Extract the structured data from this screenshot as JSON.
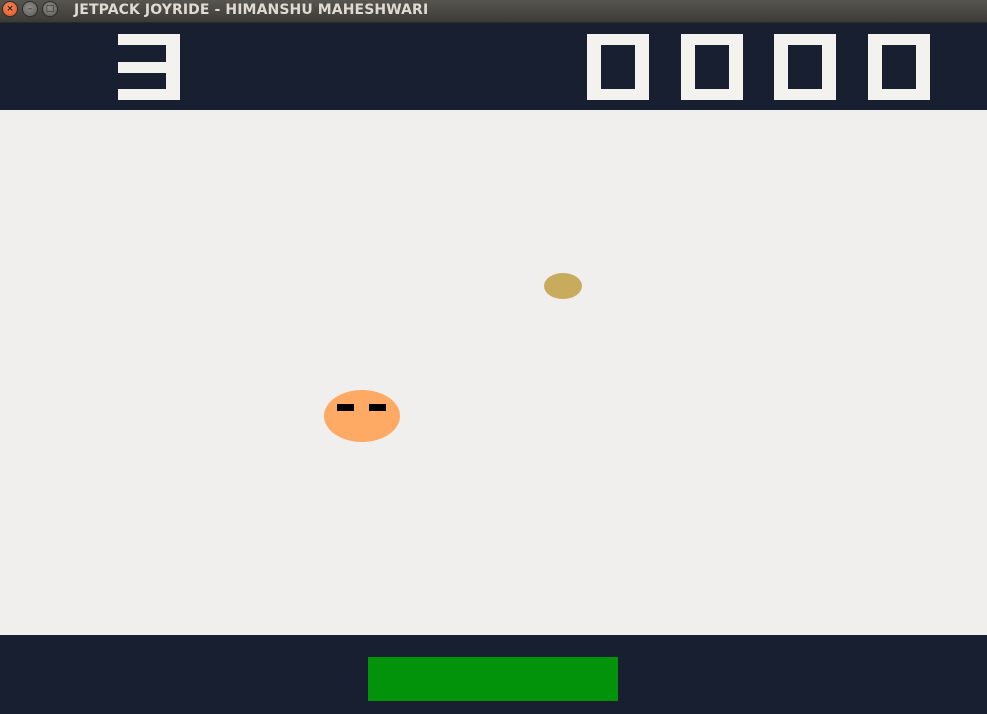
{
  "window": {
    "title": "JETPACK JOYRIDE - HIMANSHU MAHESHWARI",
    "close_glyph": "×",
    "minimize_glyph": "–",
    "maximize_glyph": "□"
  },
  "hud": {
    "lives": "3",
    "score_digits": [
      "0",
      "0",
      "0",
      "0"
    ]
  },
  "colors": {
    "hud_background": "#181f31",
    "playfield_background": "#f0efee",
    "digit_color": "#f3f2ef",
    "coin": "#c8ab5c",
    "player_body": "#ffaa64",
    "player_eyes": "#000000",
    "power_bar": "#02930a"
  },
  "icons": {
    "close": "close-icon",
    "minimize": "minimize-icon",
    "maximize": "maximize-icon"
  }
}
